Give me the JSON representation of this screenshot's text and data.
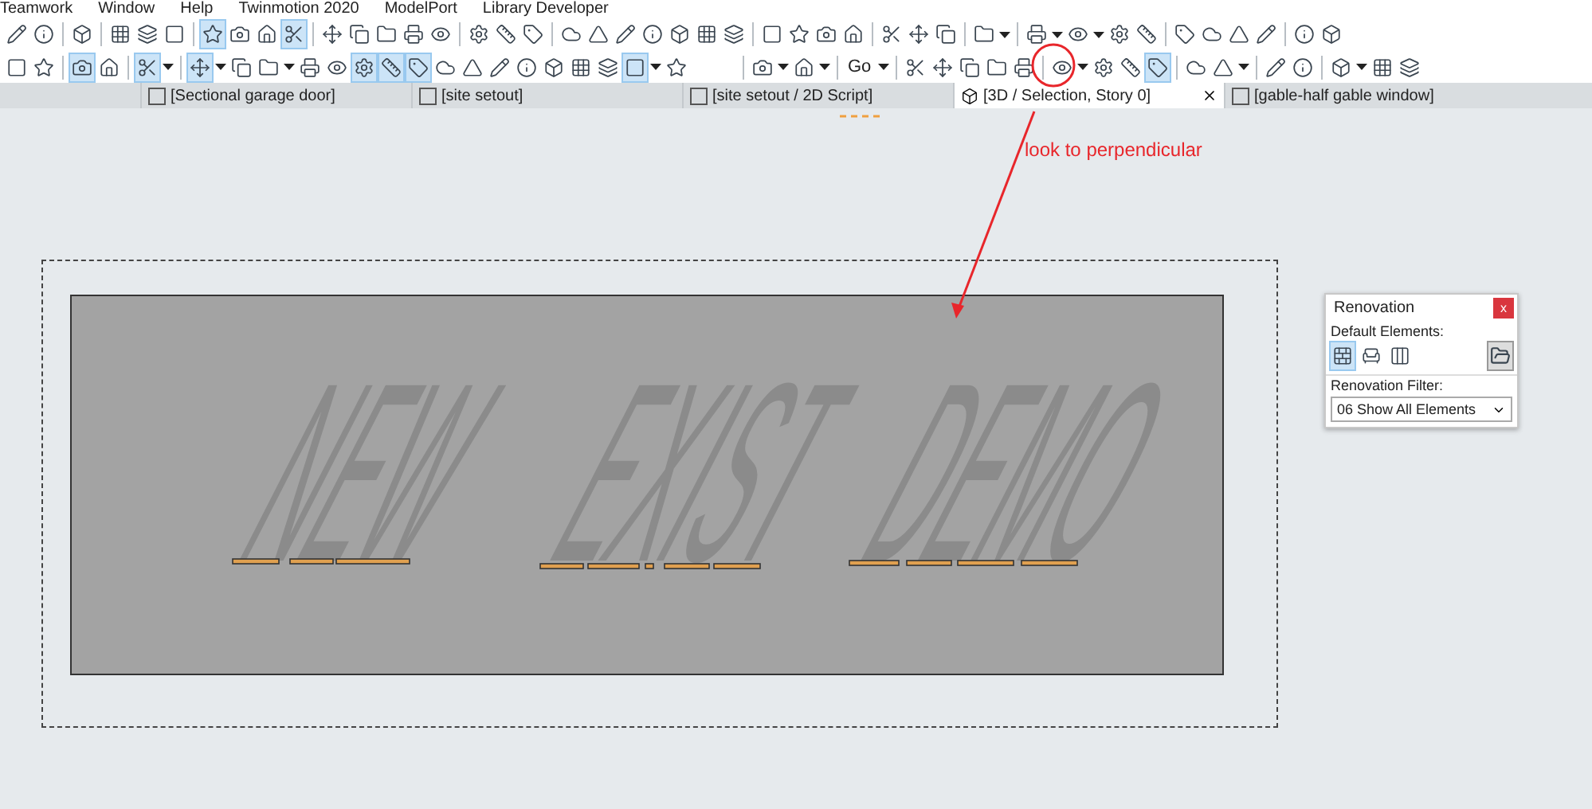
{
  "menu": [
    "Teamwork",
    "Window",
    "Help",
    "Twinmotion 2020",
    "ModelPort",
    "Library Developer"
  ],
  "toolbar_top": [
    {
      "kind": "icon",
      "selected": false
    },
    {
      "kind": "icon",
      "selected": false
    },
    {
      "kind": "sep"
    },
    {
      "kind": "icon",
      "selected": false
    },
    {
      "kind": "sep"
    },
    {
      "kind": "icon",
      "selected": false
    },
    {
      "kind": "icon",
      "selected": false
    },
    {
      "kind": "icon",
      "selected": false
    },
    {
      "kind": "sep"
    },
    {
      "kind": "icon",
      "selected": true
    },
    {
      "kind": "icon",
      "selected": false
    },
    {
      "kind": "icon",
      "selected": false
    },
    {
      "kind": "icon",
      "selected": true
    },
    {
      "kind": "sep"
    },
    {
      "kind": "icon",
      "selected": false
    },
    {
      "kind": "icon",
      "selected": false
    },
    {
      "kind": "icon",
      "selected": false
    },
    {
      "kind": "icon",
      "selected": false
    },
    {
      "kind": "icon",
      "selected": false
    },
    {
      "kind": "sep"
    },
    {
      "kind": "icon",
      "selected": false
    },
    {
      "kind": "icon",
      "selected": false
    },
    {
      "kind": "icon",
      "selected": false
    },
    {
      "kind": "sep"
    },
    {
      "kind": "icon",
      "selected": false
    },
    {
      "kind": "icon",
      "selected": false
    },
    {
      "kind": "icon",
      "selected": false
    },
    {
      "kind": "icon",
      "selected": false
    },
    {
      "kind": "icon",
      "selected": false
    },
    {
      "kind": "icon",
      "selected": false
    },
    {
      "kind": "icon",
      "selected": false
    },
    {
      "kind": "sep"
    },
    {
      "kind": "icon",
      "selected": false
    },
    {
      "kind": "icon",
      "selected": false
    },
    {
      "kind": "icon",
      "selected": false
    },
    {
      "kind": "icon",
      "selected": false
    },
    {
      "kind": "sep"
    },
    {
      "kind": "icon",
      "selected": false
    },
    {
      "kind": "icon",
      "selected": false
    },
    {
      "kind": "icon",
      "selected": false
    },
    {
      "kind": "sep"
    },
    {
      "kind": "icon",
      "selected": false
    },
    {
      "kind": "caret"
    },
    {
      "kind": "sep"
    },
    {
      "kind": "icon",
      "selected": false
    },
    {
      "kind": "caret"
    },
    {
      "kind": "icon",
      "selected": false
    },
    {
      "kind": "caret"
    },
    {
      "kind": "icon",
      "selected": false
    },
    {
      "kind": "icon",
      "selected": false
    },
    {
      "kind": "sep"
    },
    {
      "kind": "icon",
      "selected": false
    },
    {
      "kind": "icon",
      "selected": false
    },
    {
      "kind": "icon",
      "selected": false
    },
    {
      "kind": "icon",
      "selected": false
    },
    {
      "kind": "sep"
    },
    {
      "kind": "icon",
      "selected": false
    },
    {
      "kind": "icon",
      "selected": false
    }
  ],
  "toolbar_bottom": [
    {
      "kind": "icon",
      "selected": false
    },
    {
      "kind": "icon",
      "selected": false
    },
    {
      "kind": "sep"
    },
    {
      "kind": "icon",
      "selected": true
    },
    {
      "kind": "icon",
      "selected": false
    },
    {
      "kind": "sep"
    },
    {
      "kind": "icon",
      "selected": true
    },
    {
      "kind": "caret"
    },
    {
      "kind": "sep"
    },
    {
      "kind": "icon",
      "selected": true
    },
    {
      "kind": "caret"
    },
    {
      "kind": "icon",
      "selected": false
    },
    {
      "kind": "icon",
      "selected": false
    },
    {
      "kind": "caret"
    },
    {
      "kind": "icon",
      "selected": false
    },
    {
      "kind": "icon",
      "selected": false
    },
    {
      "kind": "icon",
      "selected": true
    },
    {
      "kind": "icon",
      "selected": true
    },
    {
      "kind": "icon",
      "selected": true
    },
    {
      "kind": "icon",
      "selected": false
    },
    {
      "kind": "icon",
      "selected": false
    },
    {
      "kind": "icon",
      "selected": false
    },
    {
      "kind": "icon",
      "selected": false
    },
    {
      "kind": "icon",
      "selected": false
    },
    {
      "kind": "icon",
      "selected": false
    },
    {
      "kind": "icon",
      "selected": false
    },
    {
      "kind": "icon",
      "selected": true
    },
    {
      "kind": "caret"
    },
    {
      "kind": "icon",
      "selected": false
    },
    {
      "kind": "gap"
    },
    {
      "kind": "sep"
    },
    {
      "kind": "icon",
      "selected": false
    },
    {
      "kind": "caret"
    },
    {
      "kind": "icon",
      "selected": false
    },
    {
      "kind": "caret"
    },
    {
      "kind": "sep"
    },
    {
      "kind": "text",
      "label": "Go"
    },
    {
      "kind": "caret"
    },
    {
      "kind": "sep"
    },
    {
      "kind": "icon",
      "selected": false
    },
    {
      "kind": "icon",
      "selected": false
    },
    {
      "kind": "icon",
      "selected": false
    },
    {
      "kind": "icon",
      "selected": false
    },
    {
      "kind": "icon",
      "selected": false
    },
    {
      "kind": "sep"
    },
    {
      "kind": "icon",
      "selected": false
    },
    {
      "kind": "caret"
    },
    {
      "kind": "icon",
      "selected": false
    },
    {
      "kind": "icon",
      "selected": false
    },
    {
      "kind": "icon",
      "selected": true
    },
    {
      "kind": "sep"
    },
    {
      "kind": "icon",
      "selected": false
    },
    {
      "kind": "icon",
      "selected": false
    },
    {
      "kind": "caret"
    },
    {
      "kind": "sep"
    },
    {
      "kind": "icon",
      "selected": false
    },
    {
      "kind": "icon",
      "selected": false
    },
    {
      "kind": "sep"
    },
    {
      "kind": "icon",
      "selected": false
    },
    {
      "kind": "caret"
    },
    {
      "kind": "icon",
      "selected": false
    },
    {
      "kind": "icon",
      "selected": false
    }
  ],
  "tabs": [
    {
      "label": "[Sectional garage door]",
      "selected": false
    },
    {
      "label": "[site setout]",
      "selected": false
    },
    {
      "label": "[site setout / 2D Script]",
      "selected": false
    },
    {
      "label": "[3D / Selection, Story 0]",
      "selected": true
    },
    {
      "label": "[gable-half gable window]",
      "selected": false
    }
  ],
  "model_text": [
    "NEW",
    "EXIST",
    "DEMO"
  ],
  "annotation": {
    "text": "look to perpendicular"
  },
  "renovation_panel": {
    "title": "Renovation",
    "close": "x",
    "default_elements_label": "Default Elements:",
    "default_elements": [
      {
        "selected": true
      },
      {
        "selected": false
      },
      {
        "selected": false
      }
    ],
    "filter_label": "Renovation Filter:",
    "filter_value": "06 Show All Elements"
  }
}
